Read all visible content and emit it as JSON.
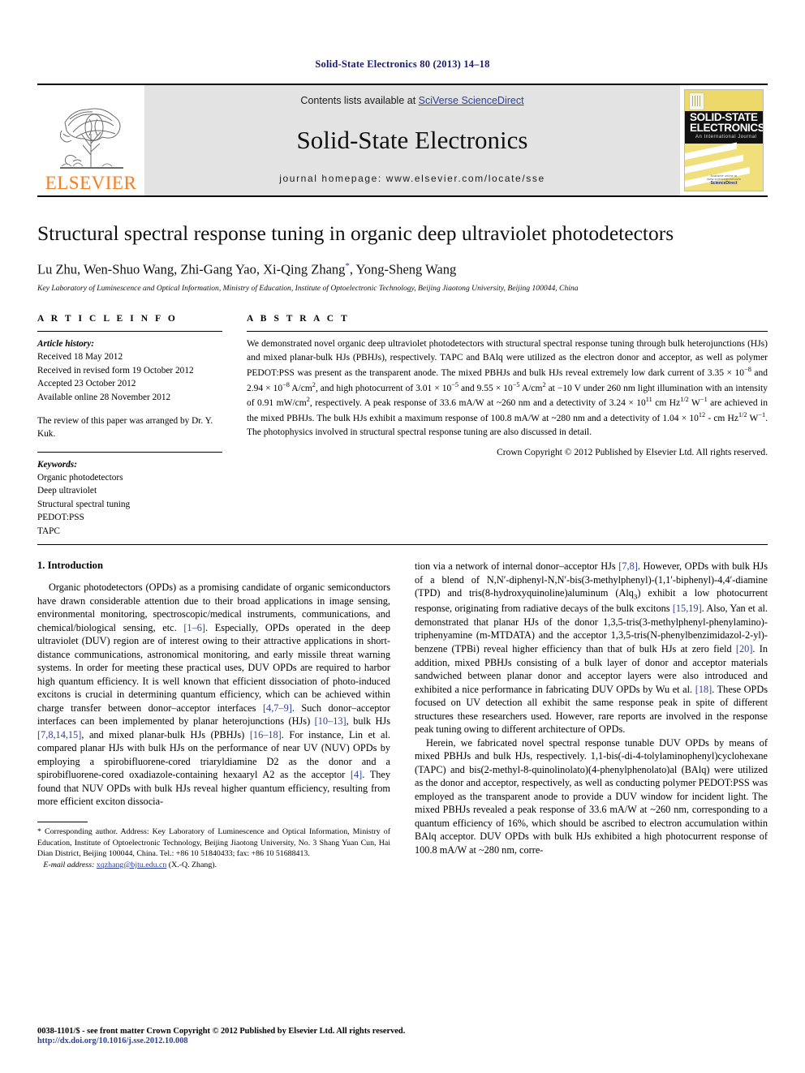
{
  "running_head": "Solid-State Electronics 80 (2013) 14–18",
  "masthead": {
    "publisher_name": "ELSEVIER",
    "contents_prefix": "Contents lists available at ",
    "sciencedirect_link": "SciVerse ScienceDirect",
    "journal_title": "Solid-State Electronics",
    "homepage": "journal homepage: www.elsevier.com/locate/sse",
    "cover": {
      "line1": "SOLID-STATE",
      "line2": "ELECTRONICS",
      "subtitle": "An International Journal",
      "foot_small": "Available online at www.sciencedirect.com",
      "foot_brand": "ScienceDirect"
    }
  },
  "paper": {
    "title": "Structural spectral response tuning in organic deep ultraviolet photodetectors",
    "authors": "Lu Zhu, Wen-Shuo Wang, Zhi-Gang Yao, Xi-Qing Zhang",
    "authors_tail": ", Yong-Sheng Wang",
    "corresponding_marker": "*",
    "affiliation": "Key Laboratory of Luminescence and Optical Information, Ministry of Education, Institute of Optoelectronic Technology, Beijing Jiaotong University, Beijing 100044, China"
  },
  "article_info": {
    "heading": "A R T I C L E   I N F O",
    "history_label": "Article history:",
    "history": [
      "Received 18 May 2012",
      "Received in revised form 19 October 2012",
      "Accepted 23 October 2012",
      "Available online 28 November 2012"
    ],
    "review_note": "The review of this paper was arranged by Dr. Y. Kuk.",
    "keywords_label": "Keywords:",
    "keywords": [
      "Organic photodetectors",
      "Deep ultraviolet",
      "Structural spectral tuning",
      "PEDOT:PSS",
      "TAPC"
    ]
  },
  "abstract": {
    "heading": "A B S T R A C T",
    "body_html": "We demonstrated novel organic deep ultraviolet photodetectors with structural spectral response tuning through bulk heterojunctions (HJs) and mixed planar-bulk HJs (PBHJs), respectively. TAPC and BAlq were utilized as the electron donor and acceptor, as well as polymer PEDOT:PSS was present as the transparent anode. The mixed PBHJs and bulk HJs reveal extremely low dark current of 3.35 &times; 10<sup>&minus;8</sup> and 2.94 &times; 10<sup>&minus;8</sup> A/cm<sup>2</sup>, and high photocurrent of 3.01 &times; 10<sup>&minus;5</sup> and 9.55 &times; 10<sup>&minus;5</sup> A/cm<sup>2</sup> at &minus;10 V under 260 nm light illumination with an intensity of 0.91 mW/cm<sup>2</sup>, respectively. A peak response of 33.6 mA/W at ~260 nm and a detectivity of 3.24 &times; 10<sup>11</sup> cm Hz<sup>1/2</sup> W<sup>&minus;1</sup> are achieved in the mixed PBHJs. The bulk HJs exhibit a maximum response of 100.8 mA/W at ~280 nm and a detectivity of 1.04 &times; 10<sup>12</sup> - cm Hz<sup>1/2</sup> W<sup>&minus;1</sup>. The photophysics involved in structural spectral response tuning are also discussed in detail.",
    "copyright": "Crown Copyright &copy; 2012 Published by Elsevier Ltd. All rights reserved."
  },
  "sections": {
    "intro_heading": "1. Introduction",
    "left_para1_html": "Organic photodetectors (OPDs) as a promising candidate of organic semiconductors have drawn considerable attention due to their broad applications in image sensing, environmental monitoring, spectroscopic/medical instruments, communications, and chemical/biological sensing, etc. <span class=\"ref\">[1&ndash;6]</span>. Especially, OPDs operated in the deep ultraviolet (DUV) region are of interest owing to their attractive applications in short-distance communications, astronomical monitoring, and early missile threat warning systems. In order for meeting these practical uses, DUV OPDs are required to harbor high quantum efficiency. It is well known that efficient dissociation of photo-induced excitons is crucial in determining quantum efficiency, which can be achieved within charge transfer between donor&ndash;acceptor interfaces <span class=\"ref\">[4,7&ndash;9]</span>. Such donor&ndash;acceptor interfaces can been implemented by planar heterojunctions (HJs) <span class=\"ref\">[10&ndash;13]</span>, bulk HJs <span class=\"ref\">[7,8,14,15]</span>, and mixed planar-bulk HJs (PBHJs) <span class=\"ref\">[16&ndash;18]</span>. For instance, Lin et al. compared planar HJs with bulk HJs on the performance of near UV (NUV) OPDs by employing a spirobifluorene-cored triaryldiamine D2 as the donor and a spirobifluorene-cored oxadiazole-containing hexaaryl A2 as the acceptor <span class=\"ref\">[4]</span>. They found that NUV OPDs with bulk HJs reveal higher quantum efficiency, resulting from more efficient exciton dissocia-",
    "right_para1_html": "tion via a network of internal donor&ndash;acceptor HJs <span class=\"ref\">[7,8]</span>. However, OPDs with bulk HJs of a blend of N,N&prime;-diphenyl-N,N&prime;-bis(3-methylphenyl)-(1,1&prime;-biphenyl)-4,4&prime;-diamine (TPD) and tris(8-hydroxyquinoline)aluminum (Alq<sub>3</sub>) exhibit a low photocurrent response, originating from radiative decays of the bulk excitons <span class=\"ref\">[15,19]</span>. Also, Yan et al. demonstrated that planar HJs of the donor 1,3,5-tris(3-methylphenyl-phenylamino)-triphenyamine (m-MTDATA) and the acceptor 1,3,5-tris(N-phenylbenzimidazol-2-yl)-benzene (TPBi) reveal higher efficiency than that of bulk HJs at zero field <span class=\"ref\">[20]</span>. In addition, mixed PBHJs consisting of a bulk layer of donor and acceptor materials sandwiched between planar donor and acceptor layers were also introduced and exhibited a nice performance in fabricating DUV OPDs by Wu et al. <span class=\"ref\">[18]</span>. These OPDs focused on UV detection all exhibit the same response peak in spite of different structures these researchers used. However, rare reports are involved in the response peak tuning owing to different architecture of OPDs.",
    "right_para2_html": "Herein, we fabricated novel spectral response tunable DUV OPDs by means of mixed PBHJs and bulk HJs, respectively. 1,1-bis(-di-4-tolylaminophenyl)cyclohexane (TAPC) and bis(2-methyl-8-quinolinolato)(4-phenylphenolato)al (BAlq) were utilized as the donor and acceptor, respectively, as well as conducting polymer PEDOT:PSS was employed as the transparent anode to provide a DUV window for incident light. The mixed PBHJs revealed a peak response of 33.6 mA/W at ~260 nm, corresponding to a quantum efficiency of 16%, which should be ascribed to electron accumulation within BAlq acceptor. DUV OPDs with bulk HJs exhibited a high photocurrent response of 100.8 mA/W at ~280 nm, corre-"
  },
  "footnote": {
    "corresponding_html": "* Corresponding author. Address: Key Laboratory of Luminescence and Optical Information, Ministry of Education, Institute of Optoelectronic Technology, Beijing Jiaotong University, No. 3 Shang Yuan Cun, Hai Dian District, Beijing 100044, China. Tel.: +86 10 51840433; fax: +86 10 51688413.",
    "email_label": "E-mail address:",
    "email": "xqzhang@bjtu.edu.cn",
    "email_owner": "(X.-Q. Zhang)."
  },
  "footer": {
    "issn_line": "0038-1101/$ - see front matter Crown Copyright © 2012 Published by Elsevier Ltd. All rights reserved.",
    "doi": "http://dx.doi.org/10.1016/j.sse.2012.10.008"
  },
  "colors": {
    "link_blue": "#2b3f9e",
    "elsevier_orange": "#F47D20",
    "banner_gray": "#e3e3e3",
    "cover_yellow": "#ecd96a"
  }
}
